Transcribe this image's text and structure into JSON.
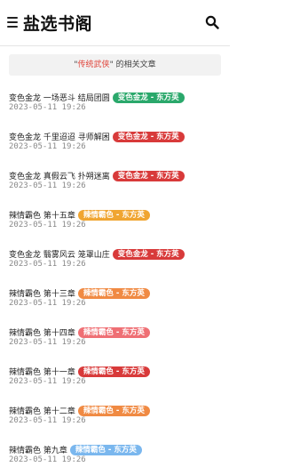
{
  "header": {
    "title": "盐选书阁"
  },
  "notice": {
    "prefix": "\"",
    "keyword": "传统武侠",
    "suffix": "\" 的相关文章"
  },
  "colors": {
    "badge_green": "#2aa86b",
    "badge_red": "#d83a3a",
    "badge_orange": "#f0a531",
    "badge_orange2": "#f08a43",
    "badge_pink": "#ef6f74",
    "badge_blue": "#7ab7ee"
  },
  "articles": [
    {
      "title": "变色金龙 一场恶斗 结局团圆",
      "tag": "变色金龙 - 东方英",
      "date": "2023-05-11 19:26",
      "tag_color": "#2aa86b"
    },
    {
      "title": "变色金龙 千里迢迢 寻师解困",
      "tag": "变色金龙 - 东方英",
      "date": "2023-05-11 19:26",
      "tag_color": "#d83a3a"
    },
    {
      "title": "变色金龙 真假云飞 扑朔迷离",
      "tag": "变色金龙 - 东方英",
      "date": "2023-05-11 19:26",
      "tag_color": "#d83a3a"
    },
    {
      "title": "辣情霸色 第十五章",
      "tag": "辣情霸色 - 东方英",
      "date": "2023-05-11 19:26",
      "tag_color": "#f0a531"
    },
    {
      "title": "变色金龙 翳雾风云 笼罩山庄",
      "tag": "变色金龙 - 东方英",
      "date": "2023-05-11 19:26",
      "tag_color": "#d83a3a"
    },
    {
      "title": "辣情霸色 第十三章",
      "tag": "辣情霸色 - 东方英",
      "date": "2023-05-11 19:26",
      "tag_color": "#f08a43"
    },
    {
      "title": "辣情霸色 第十四章",
      "tag": "辣情霸色 - 东方英",
      "date": "2023-05-11 19:26",
      "tag_color": "#ef6f74"
    },
    {
      "title": "辣情霸色 第十一章",
      "tag": "辣情霸色 - 东方英",
      "date": "2023-05-11 19:26",
      "tag_color": "#d83a3a"
    },
    {
      "title": "辣情霸色 第十二章",
      "tag": "辣情霸色 - 东方英",
      "date": "2023-05-11 19:26",
      "tag_color": "#f08a43"
    },
    {
      "title": "辣情霸色 第九章",
      "tag": "辣情霸色 - 东方英",
      "date": "2023-05-11 19:26",
      "tag_color": "#7ab7ee"
    }
  ]
}
